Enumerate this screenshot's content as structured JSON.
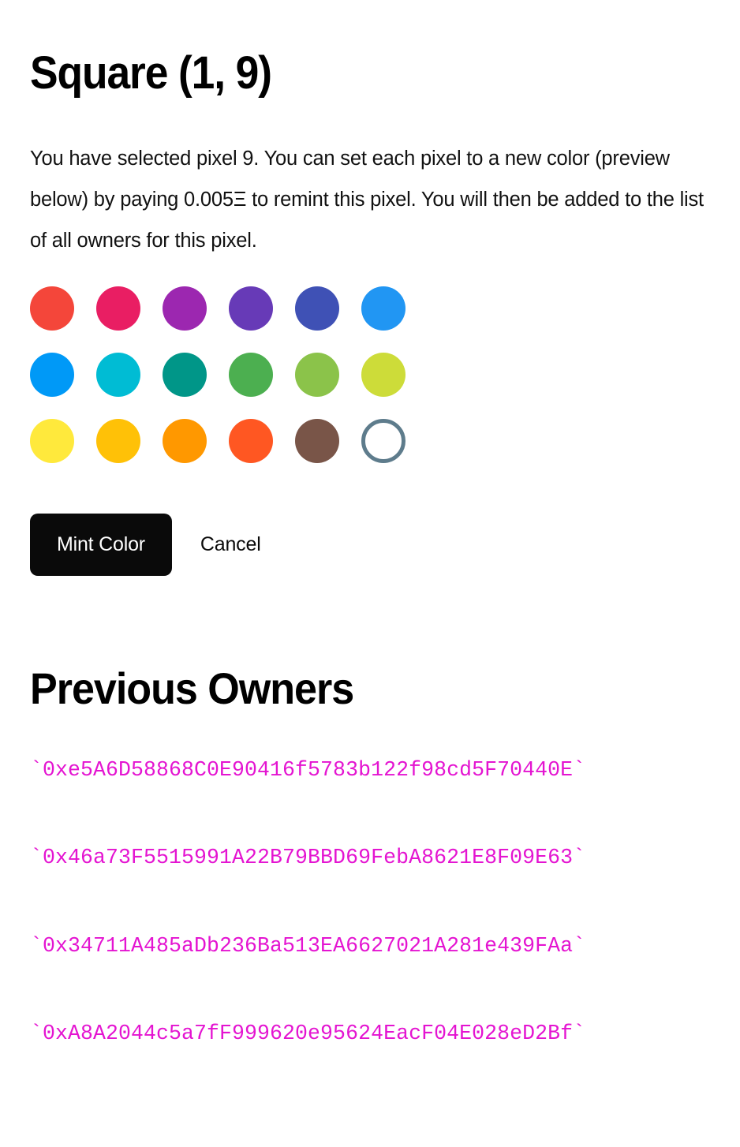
{
  "title": "Square (1, 9)",
  "intro": "You have selected pixel 9. You can set each pixel to a new color (preview below) by paying 0.005Ξ to remint this pixel. You will then be added to the list of all owners for this pixel.",
  "palette": {
    "swatches": [
      {
        "name": "red",
        "hex": "#F4463A"
      },
      {
        "name": "pink",
        "hex": "#E91E63"
      },
      {
        "name": "purple",
        "hex": "#9C27B0"
      },
      {
        "name": "deep-purple",
        "hex": "#673AB7"
      },
      {
        "name": "indigo",
        "hex": "#3F51B5"
      },
      {
        "name": "blue",
        "hex": "#2196F3"
      },
      {
        "name": "light-blue",
        "hex": "#0099F7"
      },
      {
        "name": "cyan",
        "hex": "#00BCD4"
      },
      {
        "name": "teal",
        "hex": "#009688"
      },
      {
        "name": "green",
        "hex": "#4CAF50"
      },
      {
        "name": "light-green",
        "hex": "#8BC34A"
      },
      {
        "name": "lime",
        "hex": "#CDDC39"
      },
      {
        "name": "yellow",
        "hex": "#FFE93C"
      },
      {
        "name": "amber",
        "hex": "#FFC107"
      },
      {
        "name": "orange",
        "hex": "#FF9800"
      },
      {
        "name": "deep-orange",
        "hex": "#FF5722"
      },
      {
        "name": "brown",
        "hex": "#795548"
      },
      {
        "name": "blank",
        "hex": "#FFFFFF",
        "ring": "#5E7C8C"
      }
    ]
  },
  "actions": {
    "mint_label": "Mint Color",
    "cancel_label": "Cancel"
  },
  "owners": {
    "heading": "Previous Owners",
    "items": [
      "`0xe5A6D58868C0E90416f5783b122f98cd5F70440E`",
      "`0x46a73F5515991A22B79BBD69FebA8621E8F09E63`",
      "`0x34711A485aDb236Ba513EA6627021A281e439FAa`",
      "`0xA8A2044c5a7fF999620e95624EacF04E028eD2Bf`"
    ]
  },
  "colors": {
    "address_text": "#E414D1",
    "button_bg": "#0A0A0A",
    "button_text": "#FFFFFF"
  }
}
